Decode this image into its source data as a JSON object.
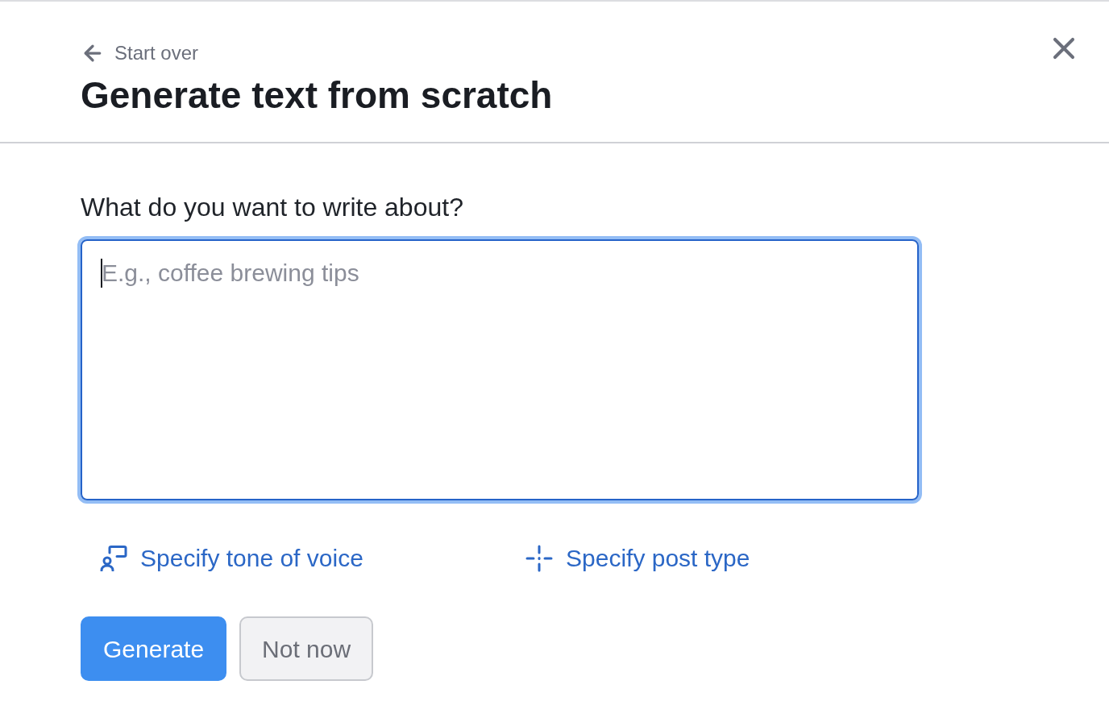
{
  "header": {
    "back_link": "Start over",
    "title": "Generate text from scratch"
  },
  "form": {
    "label": "What do you want to write about?",
    "input": {
      "placeholder": "E.g., coffee brewing tips",
      "focused": true
    }
  },
  "options": [
    {
      "label": "Specify tone of voice",
      "kind": "tone"
    },
    {
      "label": "Specify post type",
      "kind": "post-type"
    }
  ],
  "buttons": [
    {
      "label": "Generate",
      "kind": "primary"
    },
    {
      "label": "Not now",
      "kind": "secondary"
    }
  ]
}
